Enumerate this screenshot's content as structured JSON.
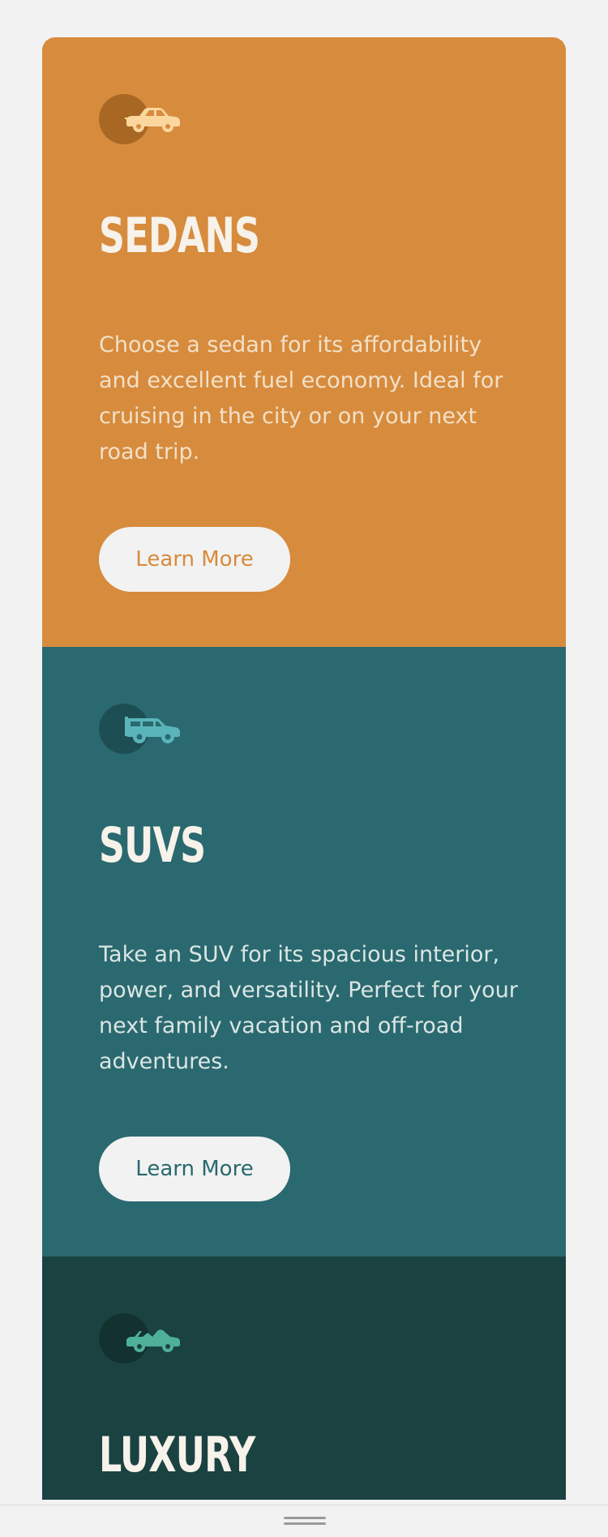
{
  "cards": [
    {
      "id": "sedans",
      "title": "SEDANS",
      "description": "Choose a sedan for its affordability and excellent fuel economy. Ideal for cruising in the city or on your next road trip.",
      "button_label": "Learn More",
      "icon": "sedan-car-icon",
      "colors": {
        "background": "#d78b3d",
        "icon": "#fbd79e",
        "button_text": "#d78b3d"
      }
    },
    {
      "id": "suvs",
      "title": "SUVS",
      "description": "Take an SUV for its spacious interior, power, and versatility. Perfect for your next family vacation and off-road adventures.",
      "button_label": "Learn More",
      "icon": "suv-car-icon",
      "colors": {
        "background": "#2a696f",
        "icon": "#5ab5ba",
        "button_text": "#2a696f"
      }
    },
    {
      "id": "luxury",
      "title": "LUXURY",
      "icon": "convertible-car-icon",
      "colors": {
        "background": "#1a4241",
        "icon": "#4fb09a"
      }
    }
  ],
  "page": {
    "background": "#f2f2f2"
  }
}
